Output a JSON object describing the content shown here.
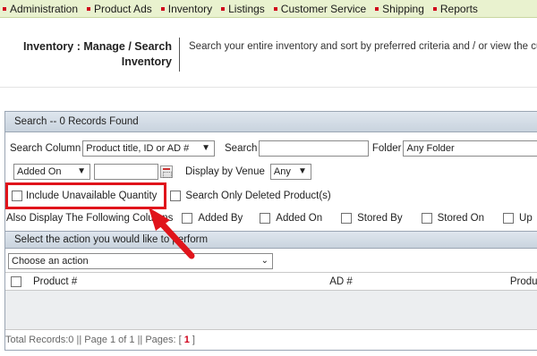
{
  "nav": {
    "items": [
      "Administration",
      "Product Ads",
      "Inventory",
      "Listings",
      "Customer Service",
      "Shipping",
      "Reports"
    ]
  },
  "header": {
    "title_line1": "Inventory : Manage / Search",
    "title_line2": "Inventory",
    "description": "Search your entire inventory and sort by preferred criteria and / or view the curre"
  },
  "panel": {
    "title": "Search -- 0 Records Found",
    "search_column_label": "Search Column",
    "search_column_value": "Product title, ID or AD #",
    "search_label": "Search",
    "folder_label": "Folder",
    "folder_value": "Any Folder",
    "date_field_value": "Added On",
    "display_by_venue_label": "Display by Venue",
    "venue_value": "Any",
    "include_unavailable_label": "Include Unavailable Quantity",
    "search_deleted_label": "Search Only Deleted Product(s)",
    "also_display_label": "Also Display The Following Columns",
    "columns": [
      "Added By",
      "Added On",
      "Stored By",
      "Stored On",
      "Up"
    ],
    "action_bar_label": "Select the action you would like to perform",
    "action_select_value": "Choose an action",
    "table_headers": [
      "Product #",
      "AD #",
      "Produ"
    ],
    "footer_prefix": "Total Records:0 || Page 1 of 1 || Pages: [",
    "footer_page": "1",
    "footer_suffix": "]"
  },
  "colors": {
    "nav_bg": "#e9f2cf",
    "nav_bullet": "#d0021b",
    "highlight": "#e0141b",
    "panel_header": "#c9d3de"
  }
}
